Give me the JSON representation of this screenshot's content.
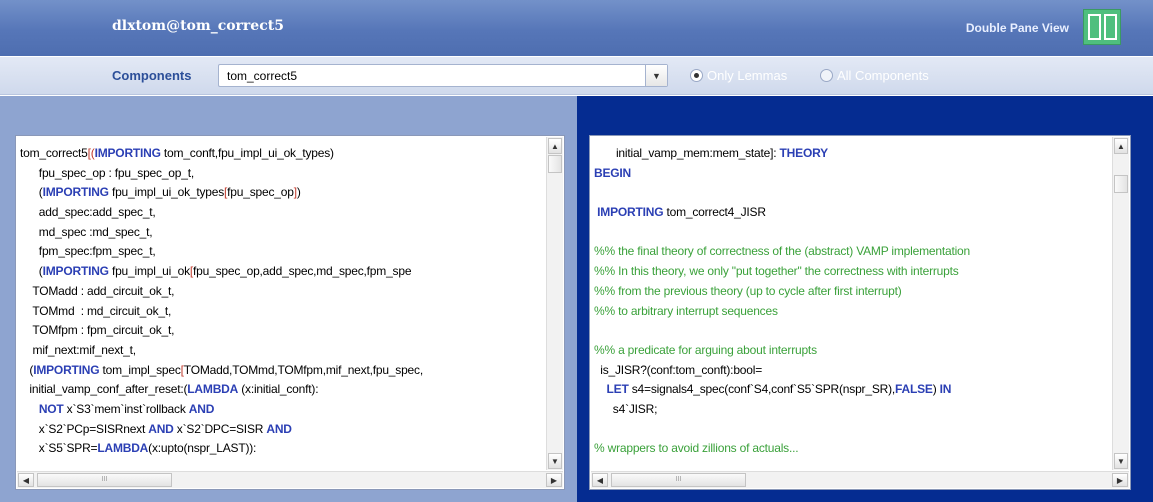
{
  "header": {
    "title": "dlxtom@tom_correct5",
    "view_label": "Double Pane View",
    "view_icon": "double-pane-icon"
  },
  "toolbar": {
    "components_label": "Components",
    "select_value": "tom_correct5",
    "radio_only_lemmas": "Only Lemmas",
    "radio_all_components": "All Components",
    "selected": "Only Lemmas"
  },
  "colors": {
    "header": "#5676b8",
    "left_pane": "#8ea4d0",
    "right_pane": "#052c91",
    "keyword": "#2b3fb4",
    "comment": "#3aa13a",
    "bracket": "#c0392b",
    "view_button": "#4fbf7e"
  },
  "left_pane": {
    "lines": [
      [
        {
          "t": "tom_correct5"
        },
        {
          "t": "[(",
          "c": "br"
        },
        {
          "t": "IMPORTING",
          "c": "kw"
        },
        {
          "t": " tom_conft,fpu_impl_ui_ok_types)"
        }
      ],
      [
        {
          "t": "      fpu_spec_op : fpu_spec_op_t,"
        }
      ],
      [
        {
          "t": "      ("
        },
        {
          "t": "IMPORTING",
          "c": "kw"
        },
        {
          "t": " fpu_impl_ui_ok_types"
        },
        {
          "t": "[",
          "c": "br"
        },
        {
          "t": "fpu_spec_op"
        },
        {
          "t": "]",
          "c": "br"
        },
        {
          "t": ")"
        }
      ],
      [
        {
          "t": "      add_spec:add_spec_t,"
        }
      ],
      [
        {
          "t": "      md_spec :md_spec_t,"
        }
      ],
      [
        {
          "t": "      fpm_spec:fpm_spec_t,"
        }
      ],
      [
        {
          "t": "      ("
        },
        {
          "t": "IMPORTING",
          "c": "kw"
        },
        {
          "t": " fpu_impl_ui_ok"
        },
        {
          "t": "[",
          "c": "br"
        },
        {
          "t": "fpu_spec_op,add_spec,md_spec,fpm_spe"
        }
      ],
      [
        {
          "t": "    TOMadd : add_circuit_ok_t,"
        }
      ],
      [
        {
          "t": "    TOMmd  : md_circuit_ok_t,"
        }
      ],
      [
        {
          "t": "    TOMfpm : fpm_circuit_ok_t,"
        }
      ],
      [
        {
          "t": "    mif_next:mif_next_t,"
        }
      ],
      [
        {
          "t": "   ("
        },
        {
          "t": "IMPORTING",
          "c": "kw"
        },
        {
          "t": " tom_impl_spec"
        },
        {
          "t": "[",
          "c": "br"
        },
        {
          "t": "TOMadd,TOMmd,TOMfpm,mif_next,fpu_spec,"
        }
      ],
      [
        {
          "t": "   initial_vamp_conf_after_reset:("
        },
        {
          "t": "LAMBDA",
          "c": "kw"
        },
        {
          "t": " (x:initial_conft):"
        }
      ],
      [
        {
          "t": "      "
        },
        {
          "t": "NOT",
          "c": "kw"
        },
        {
          "t": " x`S3`mem`inst`rollback "
        },
        {
          "t": "AND",
          "c": "kw"
        }
      ],
      [
        {
          "t": "      x`S2`PCp=SISRnext "
        },
        {
          "t": "AND",
          "c": "kw"
        },
        {
          "t": " x`S2`DPC=SISR "
        },
        {
          "t": "AND",
          "c": "kw"
        }
      ],
      [
        {
          "t": "      x`S5`SPR="
        },
        {
          "t": "LAMBDA",
          "c": "kw"
        },
        {
          "t": "(x:upto(nspr_LAST)):"
        }
      ]
    ]
  },
  "right_pane": {
    "lines": [
      [
        {
          "t": "       initial_vamp_mem:mem_state]: "
        },
        {
          "t": "THEORY",
          "c": "kw"
        }
      ],
      [
        {
          "t": "BEGIN",
          "c": "kw"
        }
      ],
      [
        {
          "t": ""
        }
      ],
      [
        {
          "t": " "
        },
        {
          "t": "IMPORTING",
          "c": "kw"
        },
        {
          "t": " tom_correct4_JISR"
        }
      ],
      [
        {
          "t": ""
        }
      ],
      [
        {
          "t": "%% the final theory of correctness of the (abstract) VAMP implementation",
          "c": "gr"
        }
      ],
      [
        {
          "t": "%% In this theory, we only \"put together\" the correctness with interrupts",
          "c": "gr"
        }
      ],
      [
        {
          "t": "%% from the previous theory (up to cycle after first interrupt)",
          "c": "gr"
        }
      ],
      [
        {
          "t": "%% to arbitrary interrupt sequences",
          "c": "gr"
        }
      ],
      [
        {
          "t": ""
        }
      ],
      [
        {
          "t": "%% a predicate for arguing about interrupts",
          "c": "gr"
        }
      ],
      [
        {
          "t": "  is_JISR?(conf:tom_conft):bool="
        }
      ],
      [
        {
          "t": "    "
        },
        {
          "t": "LET",
          "c": "kw"
        },
        {
          "t": " s4=signals4_spec(conf`S4,conf`S5`SPR(nspr_SR),"
        },
        {
          "t": "FALSE",
          "c": "kw"
        },
        {
          "t": ") "
        },
        {
          "t": "IN",
          "c": "kw"
        }
      ],
      [
        {
          "t": "      s4`JISR;"
        }
      ],
      [
        {
          "t": ""
        }
      ],
      [
        {
          "t": "% wrappers to avoid zillions of actuals...",
          "c": "gr"
        }
      ]
    ]
  },
  "scroll_icons": {
    "up": "▲",
    "down": "▼",
    "left": "◀",
    "right": "▶",
    "grip": "III"
  }
}
